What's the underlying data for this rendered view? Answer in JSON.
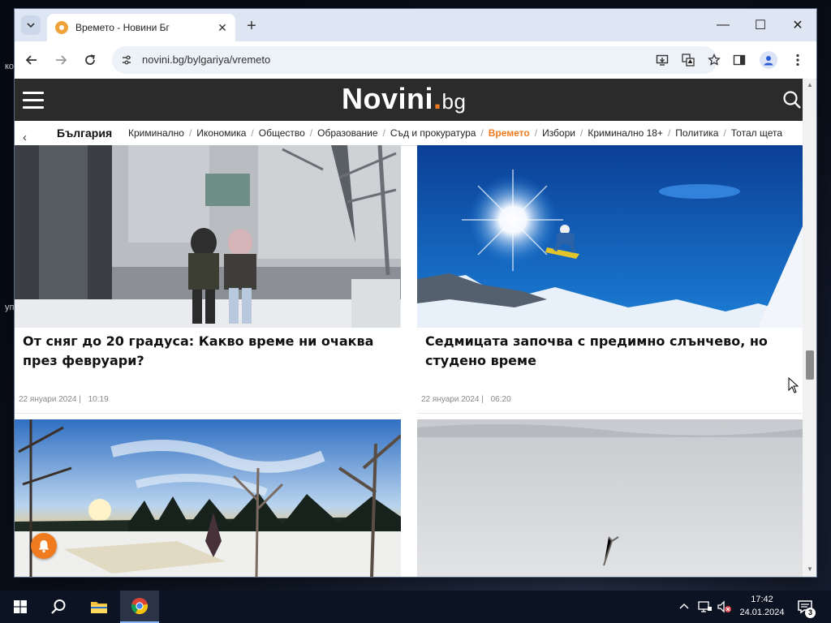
{
  "desktop": {
    "fragments": [
      "ко",
      "уп"
    ]
  },
  "browser": {
    "tab": {
      "title": "Времето - Новини Бг"
    },
    "url": "novini.bg/bylgariya/vremeto",
    "window_controls": {
      "minimize": "—",
      "maximize": "☐",
      "close": "✕"
    }
  },
  "site": {
    "logo_main": "Novini",
    "logo_dot": ".",
    "logo_tld": "bg",
    "category": "България",
    "nav_items": [
      {
        "label": "Криминално",
        "active": false
      },
      {
        "label": "Икономика",
        "active": false
      },
      {
        "label": "Общество",
        "active": false
      },
      {
        "label": "Образование",
        "active": false
      },
      {
        "label": "Съд и прокуратура",
        "active": false
      },
      {
        "label": "Времето",
        "active": true
      },
      {
        "label": "Избори",
        "active": false
      },
      {
        "label": "Криминално 18+",
        "active": false
      },
      {
        "label": "Политика",
        "active": false
      },
      {
        "label": "Тотал щета",
        "active": false
      }
    ],
    "articles": [
      {
        "headline": "От сняг до 20 градуса: Какво време ни очаква през февруари?",
        "date": "22 януари 2024",
        "time": "10:19"
      },
      {
        "headline": "Седмицата започва с предимно слънчево, но студено време",
        "date": "22 януари 2024",
        "time": "06:20"
      }
    ]
  },
  "taskbar": {
    "time": "17:42",
    "date": "24.01.2024",
    "notification_count": "3"
  },
  "colors": {
    "accent": "#f07b1e",
    "header_bg": "#2b2b2b",
    "titlebar_bg": "#dfe6f3"
  }
}
